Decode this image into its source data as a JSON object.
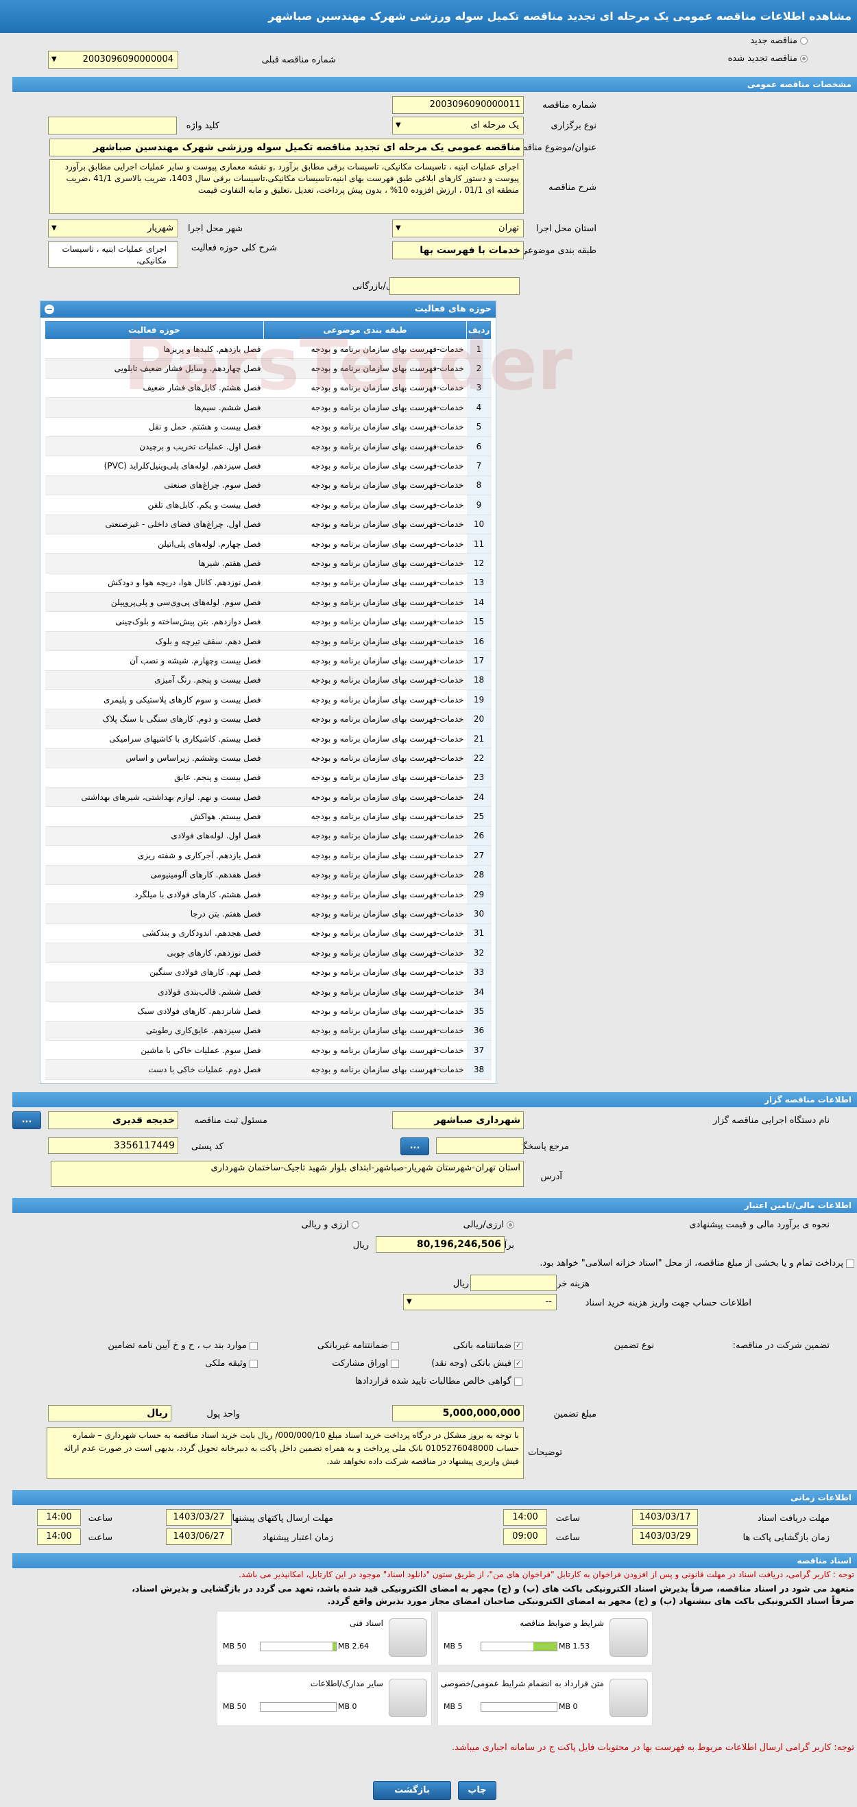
{
  "header": {
    "title": "مشاهده اطلاعات مناقصه عمومی یک مرحله ای تجدید مناقصه تکمیل سوله ورزشی شهرک مهندسین صباشهر"
  },
  "top": {
    "new_label": "مناقصه جدید",
    "renewed_label": "مناقصه تجدید شده",
    "prev_no_label": "شماره مناقصه قبلی",
    "prev_no_value": "2003096090000004"
  },
  "sections": {
    "specs": "مشخصات مناقصه عمومی",
    "organizer": "اطلاعات مناقصه گزار",
    "finance": "اطلاعات مالی/تامین اعتبار",
    "time": "اطلاعات زمانی",
    "docs": "اسناد مناقصه"
  },
  "specs": {
    "no_label": "شماره مناقصه",
    "no_value": "2003096090000011",
    "type_label": "نوع برگزاری",
    "type_value": "یک مرحله ای",
    "keyword_label": "کلید واژه",
    "keyword_value": "",
    "title_label": "عنوان/موضوع مناقصه",
    "title_value": "مناقصه عمومی یک مرحله ای تجدید مناقصه تکمیل سوله ورزشی شهرک مهندسین صباشهر",
    "desc_label": "شرح مناقصه",
    "desc_value": "اجرای عملیات ابنیه ، تاسیسات مکانیکی، تاسیسات برقی مطابق برآورد ,و نقشه معماری پیوست و سایر عملیات اجرایی مطابق برآورد پیوست و دستور کارهای ابلاغی طبق فهرست بهای ابنیه،تاسیسات مکانیکی،تاسیسات برقی سال 1403، ضریب بالاسری 41/1 ،ضریب منطقه ای 01/1 ، ارزش افزوده 10% ، بدون پیش پرداخت، تعدیل ،تعلیق و مابه التفاوت قیمت",
    "province_label": "استان محل اجرا",
    "province_value": "تهران",
    "city_label": "شهر محل اجرا",
    "city_value": "شهریار",
    "category_label": "طبقه بندی موضوعی",
    "category_value": "خدمات با فهرست بها",
    "scope_label": "شرح کلی حوزه فعالیت",
    "scope_value": "اجرای عملیات ابنیه ، تاسیسات مکانیکی،",
    "min_score_label": "حداقل امتیاز قابل قبول ارزیابی فنی/بازرگانی",
    "min_score_value": ""
  },
  "activity": {
    "panel_title": "حوزه های فعالیت",
    "headers": [
      "ردیف",
      "طبقه بندی موضوعی",
      "حوزه فعالیت"
    ],
    "category": "خدمات-فهرست بهای سازمان برنامه و بودجه",
    "rows": [
      {
        "n": "1",
        "a": "فصل یازدهم. کلیدها و پریزها"
      },
      {
        "n": "2",
        "a": "فصل چهاردهم. وسایل فشار ضعیف تابلویی"
      },
      {
        "n": "3",
        "a": "فصل هشتم. کابل‌های فشار ضعیف"
      },
      {
        "n": "4",
        "a": "فصل ششم. سیم‌ها"
      },
      {
        "n": "5",
        "a": "فصل بیست و هشتم. حمل و نقل"
      },
      {
        "n": "6",
        "a": "فصل اول. عملیات تخریب و برچیدن"
      },
      {
        "n": "7",
        "a": "فصل سیزدهم. لوله‌های پلی‌وینیل‌کلراید (PVC)"
      },
      {
        "n": "8",
        "a": "فصل سوم. چراغ‌های صنعتی"
      },
      {
        "n": "9",
        "a": "فصل بیست و یکم. کابل‌های تلفن"
      },
      {
        "n": "10",
        "a": "فصل اول. چراغ‌های فضای داخلی - غیرصنعتی"
      },
      {
        "n": "11",
        "a": "فصل چهارم. لوله‌های پلی‌اتیلن"
      },
      {
        "n": "12",
        "a": "فصل هفتم. شیرها"
      },
      {
        "n": "13",
        "a": "فصل نوزدهم. کانال هوا، دریچه هوا و دودکش"
      },
      {
        "n": "14",
        "a": "فصل سوم. لوله‌های پی‌وی‌سی و پلی‌پروپیلن"
      },
      {
        "n": "15",
        "a": "فصل دوازدهم. بتن پیش‌ساخته و بلوک‌چینی"
      },
      {
        "n": "16",
        "a": "فصل دهم. سقف تیرچه و بلوک"
      },
      {
        "n": "17",
        "a": "فصل بیست وچهارم. شیشه و نصب آن"
      },
      {
        "n": "18",
        "a": "فصل بیست و پنجم. رنگ آمیزی"
      },
      {
        "n": "19",
        "a": "فصل بیست و سوم کارهای پلاستیکی و پلیمری"
      },
      {
        "n": "20",
        "a": "فصل بیست و دوم. کارهای سنگی با سنگ پلاک"
      },
      {
        "n": "21",
        "a": "فصل بیستم. کاشیکاری با کاشیهای سرامیکی"
      },
      {
        "n": "22",
        "a": "فصل بیست وششم. زیراساس و اساس"
      },
      {
        "n": "23",
        "a": "فصل بیست و پنجم. عایق"
      },
      {
        "n": "24",
        "a": "فصل بیست و نهم. لوازم بهداشتی، شیرهای بهداشتی"
      },
      {
        "n": "25",
        "a": "فصل بیستم. هواکش"
      },
      {
        "n": "26",
        "a": "فصل اول. لوله‌های فولادی"
      },
      {
        "n": "27",
        "a": "فصل یازدهم. آجرکاری و شفته ریزی"
      },
      {
        "n": "28",
        "a": "فصل هفدهم. کارهای آلومینیومی"
      },
      {
        "n": "29",
        "a": "فصل هشتم. کارهای فولادی با میلگرد"
      },
      {
        "n": "30",
        "a": "فصل هفتم. بتن درجا"
      },
      {
        "n": "31",
        "a": "فصل هجدهم. اندودکاری و بندکشی"
      },
      {
        "n": "32",
        "a": "فصل نوزدهم. کارهای چوبی"
      },
      {
        "n": "33",
        "a": "فصل نهم. کارهای فولادی سنگین"
      },
      {
        "n": "34",
        "a": "فصل ششم. قالب‌بندی فولادی"
      },
      {
        "n": "35",
        "a": "فصل شانزدهم. کارهای فولادی سبک"
      },
      {
        "n": "36",
        "a": "فصل سیزدهم. عایق‌کاری رطوبتی"
      },
      {
        "n": "37",
        "a": "فصل سوم. عملیات خاکی با ماشین"
      },
      {
        "n": "38",
        "a": "فصل دوم. عملیات خاکی با دست"
      }
    ]
  },
  "organizer": {
    "org_label": "نام دستگاه اجرایی مناقصه گزار",
    "org_value": "شهرداری صباشهر",
    "resp_label": "مسئول ثبت مناقصه",
    "resp_value": "خدیجه قدیری",
    "ref_label": "مرجع پاسخگویی",
    "ref_value": "",
    "postal_label": "کد پستی",
    "postal_value": "3356117449",
    "addr_label": "آدرس",
    "addr_value": "استان تهران-شهرستان شهریار-صباشهر-ابتدای بلوار شهید تاجیک-ساختمان شهرداری",
    "dots": "..."
  },
  "finance": {
    "method_label": "نحوه ی برآورد مالی و قیمت پیشنهادی",
    "opt_currency": "ارزی/ریالی",
    "opt_both": "ارزی و ریالی",
    "estimate_label": "برآورد مالی",
    "estimate_value": "80,196,246,506",
    "estimate_unit": "ریال",
    "treasury_text": "پرداخت تمام و یا بخشی از مبلغ مناقصه، از محل \"اسناد خزانه اسلامی\" خواهد بود.",
    "doc_cost_label": "هزینه خرید اسناد",
    "doc_cost_value": "",
    "doc_cost_unit": "ریال",
    "account_label": "اطلاعات حساب جهت واریز هزینه خرید اسناد",
    "account_value": "--",
    "guarantee_label": "تضمین شرکت در مناقصه:",
    "guarantee_type_label": "نوع تضمین",
    "g1": "ضمانتنامه بانکی",
    "g2": "ضمانتنامه غیربانکی",
    "g3": "موارد بند ب ، ح و خ آیین نامه تضامین",
    "g4": "فیش بانکی (وجه نقد)",
    "g5": "اوراق مشارکت",
    "g6": "وثیقه ملکی",
    "g7": "گواهی خالص مطالبات تایید شده قراردادها",
    "amount_label": "مبلغ تضمین",
    "amount_value": "5,000,000,000",
    "unit_label": "واحد پول",
    "unit_value": "ریال",
    "notes_label": "توضیحات",
    "notes_value": "با توجه به بروز مشکل در درگاه پرداخت خرید اسناد مبلغ 000/000/10/ ریال بابت خرید اسناد مناقصه به حساب شهرداری – شماره حساب 0105276048000 بانک ملی پرداخت و به همراه تضمین داخل پاکت به دبیرخانه تحویل گردد، بدیهی است در صورت عدم ارائه فیش واریزی پیشنهاد در مناقصه شرکت داده نخواهد شد."
  },
  "time": {
    "receive_label": "مهلت دریافت اسناد",
    "receive_date": "1403/03/17",
    "receive_time": "14:00",
    "send_label": "مهلت ارسال پاکتهای پیشنهادی",
    "send_date": "1403/03/27",
    "send_time": "14:00",
    "open_label": "زمان بازگشایی پاکت ها",
    "open_date": "1403/03/29",
    "open_time": "09:00",
    "validity_label": "زمان اعتبار پیشنهاد",
    "validity_date": "1403/06/27",
    "validity_time": "14:00",
    "time_label": "ساعت"
  },
  "docs": {
    "note1": "توجه : کاربر گرامی، دریافت اسناد در مهلت قانونی و پس از افزودن فراخوان به کارتابل \"فراخوان های من\"، از طریق ستون \"دانلود اسناد\" موجود در این کارتابل، امکانپذیر می باشد.",
    "note2": "متعهد می شود در اسناد مناقصه، صرفاً بذیرش اسناد الکترونیکی باکت های (ب) و (ج) مجهر به امضای الکترونیکی قید شده باشد، تعهد می گردد در بازگشایی و بذیرش اسناد،",
    "note3": "صرفاً اسناد الکترونیکی باکت های بیشنهاد (ب) و (ج) مجهر به امضای الکترونیکی صاحبان امضای مجاز مورد بذیرش واقع گردد.",
    "items": [
      {
        "title": "شرایط و ضوابط مناقصه",
        "size": "1.53 MB",
        "max": "5 MB",
        "fill": 0.31
      },
      {
        "title": "اسناد فنی",
        "size": "2.64 MB",
        "max": "50 MB",
        "fill": 0.05
      },
      {
        "title": "متن قرارداد به انضمام شرایط عمومی/خصوصی",
        "size": "0 MB",
        "max": "5 MB",
        "fill": 0
      },
      {
        "title": "سایر مدارک/اطلاعات",
        "size": "0 MB",
        "max": "50 MB",
        "fill": 0
      }
    ],
    "note4": "توجه: کاربر گرامی ارسال اطلاعات مربوط به فهرست بها در محتویات فایل پاکت ج در سامانه اجباری میباشد."
  },
  "footer": {
    "print": "چاپ",
    "back": "بازگشت"
  }
}
